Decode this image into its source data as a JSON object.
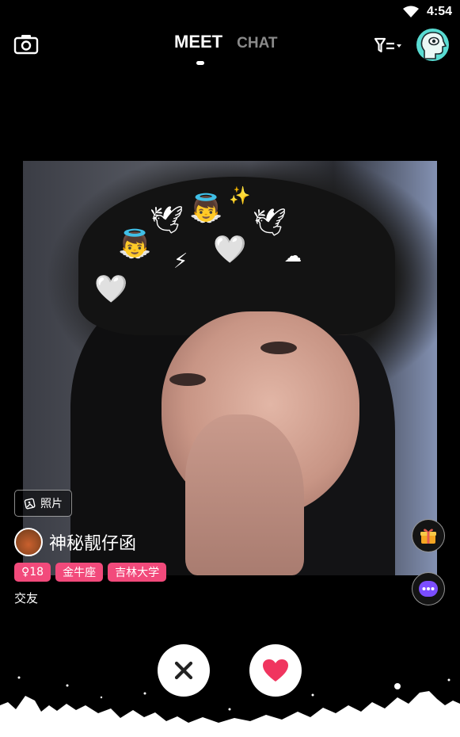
{
  "status_bar": {
    "time": "4:54"
  },
  "nav": {
    "tabs": [
      {
        "label": "MEET",
        "active": true
      },
      {
        "label": "CHAT",
        "active": false
      }
    ],
    "camera_icon": "camera-icon",
    "filter_icon": "filter-icon",
    "avatar_icon": "head-avatar-icon"
  },
  "card": {
    "photo_tag": "照片",
    "name": "神秘靓仔函",
    "tags": [
      "♀18",
      "金牛座",
      "吉林大学"
    ],
    "bio": "交友"
  },
  "actions": {
    "dislike_icon": "close-icon",
    "like_icon": "heart-icon",
    "gift_icon": "gift-icon",
    "more_icon": "more-icon"
  },
  "colors": {
    "background": "#000000",
    "tag": "#f24a7b",
    "like": "#f0355f",
    "more": "#7b4dff",
    "avatar_bg": "#59dcd3"
  }
}
